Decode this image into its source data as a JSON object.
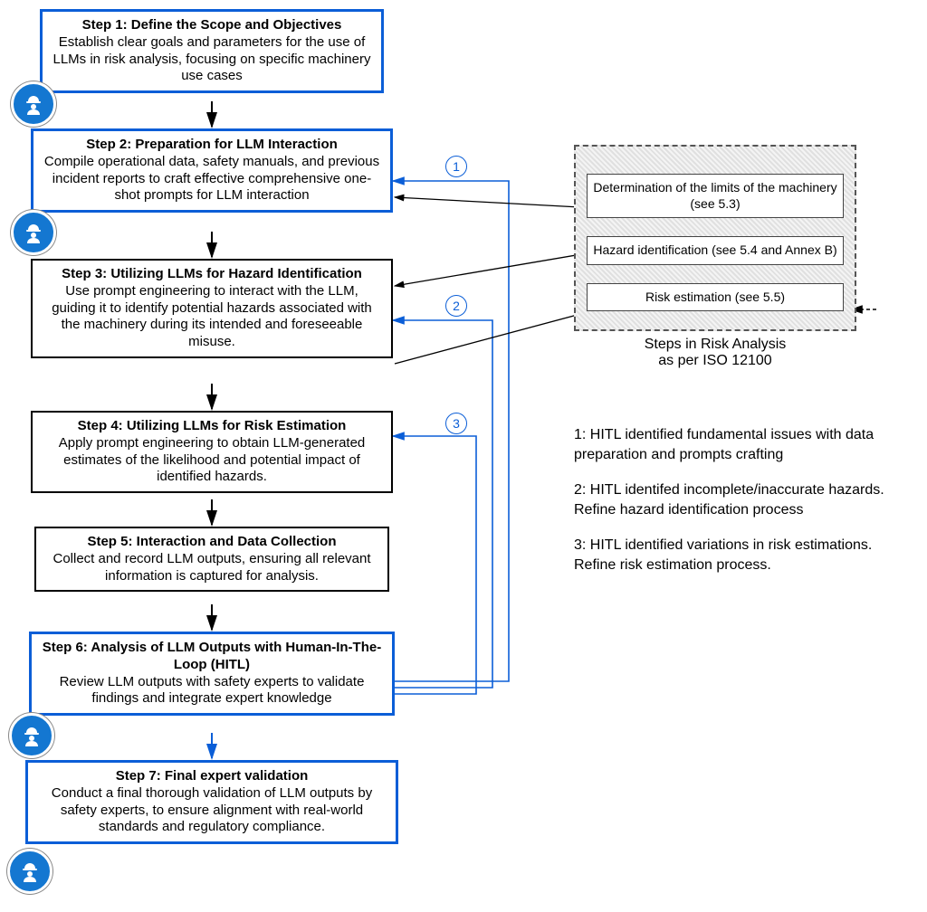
{
  "steps": [
    {
      "title": "Step 1: Define the Scope and Objectives",
      "body": "Establish clear goals and parameters for the use of LLMs in risk analysis, focusing on specific machinery use cases",
      "style": "blue"
    },
    {
      "title": "Step 2: Preparation for LLM Interaction",
      "body": "Compile operational data, safety manuals, and previous incident reports to craft effective comprehensive one-shot prompts for LLM interaction",
      "style": "blue"
    },
    {
      "title": "Step 3: Utilizing LLMs for Hazard Identification",
      "body": "Use prompt engineering to interact with the LLM, guiding it to identify potential hazards associated with the machinery during its intended and foreseeable misuse.",
      "style": "black"
    },
    {
      "title": "Step 4: Utilizing LLMs for Risk Estimation",
      "body": "Apply prompt engineering to obtain LLM-generated estimates of the likelihood and potential impact of identified hazards.",
      "style": "black"
    },
    {
      "title": "Step 5: Interaction and Data Collection",
      "body": "Collect and record LLM outputs, ensuring all relevant information is captured for analysis.",
      "style": "black"
    },
    {
      "title": "Step 6: Analysis of LLM Outputs with Human-In-The-Loop (HITL)",
      "body": "Review LLM outputs with safety experts to validate findings and integrate expert knowledge",
      "style": "blue"
    },
    {
      "title": "Step 7: Final expert validation",
      "body": "Conduct a final thorough validation of LLM outputs by safety experts, to ensure alignment with real-world standards and regulatory compliance.",
      "style": "blue"
    }
  ],
  "iso": {
    "items": [
      "Determination of the limits of the machinery (see 5.3)",
      "Hazard identification (see 5.4 and Annex B)",
      "Risk estimation (see 5.5)"
    ],
    "caption_line1": "Steps in Risk Analysis",
    "caption_line2": "as per ISO 12100"
  },
  "feedback_badges": [
    "1",
    "2",
    "3"
  ],
  "legend": [
    "1: HITL  identified fundamental issues with data preparation and prompts crafting",
    "2: HITL identifed incomplete/inaccurate hazards. Refine hazard identification process",
    "3: HITL identified variations in risk estimations. Refine risk estimation process."
  ],
  "colors": {
    "blue": "#0b5ed7",
    "badge": "#1477d1"
  }
}
